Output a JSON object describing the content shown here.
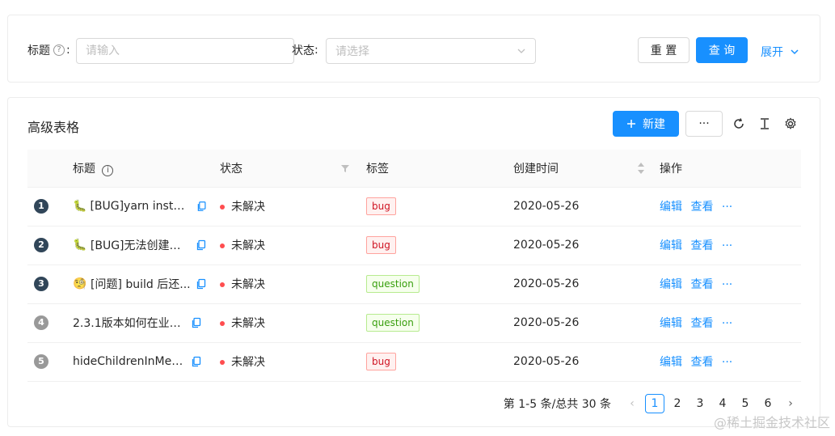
{
  "search": {
    "title_label": "标题",
    "title_placeholder": "请输入",
    "status_label": "状态",
    "status_placeholder": "请选择",
    "reset_label": "重 置",
    "query_label": "查 询",
    "expand_label": "展开"
  },
  "table": {
    "heading": "高级表格",
    "new_label": "新建",
    "more_label": "···",
    "columns": [
      "标题",
      "状态",
      "标签",
      "创建时间",
      "操作"
    ],
    "rows": [
      {
        "index": "1",
        "emoji": "🐛",
        "title": "[BUG]yarn install...",
        "status": "未解决",
        "tag": "bug",
        "date": "2020-05-26",
        "edit": "编辑",
        "view": "查看",
        "more": "···"
      },
      {
        "index": "2",
        "emoji": "🐛",
        "title": "[BUG]无法创建工...",
        "status": "未解决",
        "tag": "bug",
        "date": "2020-05-26",
        "edit": "编辑",
        "view": "查看",
        "more": "···"
      },
      {
        "index": "3",
        "emoji": "🧐",
        "title": "[问题] build 后还...",
        "status": "未解决",
        "tag": "question",
        "date": "2020-05-26",
        "edit": "编辑",
        "view": "查看",
        "more": "···"
      },
      {
        "index": "4",
        "emoji": "",
        "title": "2.3.1版本如何在业务...",
        "status": "未解决",
        "tag": "question",
        "date": "2020-05-26",
        "edit": "编辑",
        "view": "查看",
        "more": "···"
      },
      {
        "index": "5",
        "emoji": "",
        "title": "hideChildrenInMenu...",
        "status": "未解决",
        "tag": "bug",
        "date": "2020-05-26",
        "edit": "编辑",
        "view": "查看",
        "more": "···"
      }
    ]
  },
  "pagination": {
    "total_text": "第 1-5 条/总共 30 条",
    "prev": "‹",
    "next": "›",
    "pages": [
      "1",
      "2",
      "3",
      "4",
      "5",
      "6"
    ],
    "current": "1"
  },
  "watermark": "@稀土掘金技术社区",
  "colors": {
    "primary": "#1890ff",
    "badge_dark": "#314659",
    "badge_light": "#999999",
    "bug_tag_bg": "#fff1f0",
    "bug_tag_border": "#ffa39e",
    "bug_tag_text": "#cf1322",
    "question_tag_bg": "#f6ffed",
    "question_tag_border": "#b7eb8f",
    "question_tag_text": "#389e0d"
  }
}
